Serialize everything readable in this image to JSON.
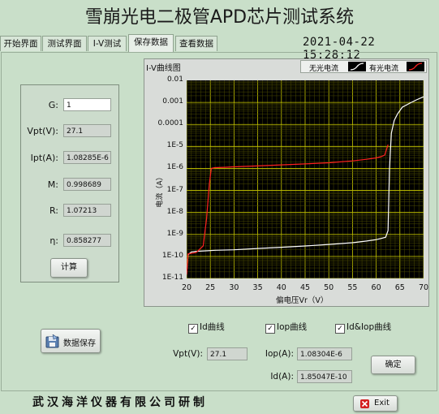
{
  "app": {
    "title": "雪崩光电二极管APD芯片测试系统"
  },
  "tabs": [
    {
      "label": "开始界面"
    },
    {
      "label": "测试界面"
    },
    {
      "label": "I-V测试"
    },
    {
      "label": "保存数据"
    },
    {
      "label": "查看数据"
    }
  ],
  "active_tab": "保存数据",
  "datetime": "2021-04-22  15:28:12",
  "params": {
    "g_label": "G:",
    "g_value": "1",
    "vpt_label": "Vpt(V):",
    "vpt_value": "27.1",
    "ipt_label": "Ipt(A):",
    "ipt_value": "1.08285E-6",
    "m_label": "M:",
    "m_value": "0.998689",
    "r_label": "R:",
    "r_value": "1.07213",
    "eta_label": "η:",
    "eta_value": "0.858277",
    "calc_button": "计算"
  },
  "save_button": "数据保存",
  "graph": {
    "title": "I-V曲线图",
    "legend_dark": "无光电流",
    "legend_light": "有光电流",
    "ylabel": "电流（A）",
    "xlabel": "偏电压Vr（V）"
  },
  "chart_data": {
    "type": "line",
    "title": "I-V曲线图",
    "xlabel": "偏电压Vr（V）",
    "ylabel": "电流（A）",
    "xlim": [
      20,
      70
    ],
    "ylim": [
      1e-11,
      0.01
    ],
    "y_scale": "log",
    "x_ticks": [
      "20",
      "25",
      "30",
      "35",
      "40",
      "45",
      "50",
      "55",
      "60",
      "65",
      "70"
    ],
    "y_ticks": [
      "1E-11",
      "1E-10",
      "1E-9",
      "1E-8",
      "1E-7",
      "1E-6",
      "1E-5",
      "0.0001",
      "0.001",
      "0.01"
    ],
    "grid": true,
    "legend_position": "top-right",
    "series": [
      {
        "name": "无光电流",
        "color": "#ffffff",
        "x": [
          20,
          20.3,
          21,
          22,
          24,
          26,
          30,
          35,
          40,
          45,
          50,
          55,
          58,
          60,
          61,
          62,
          62.5,
          62.8,
          63.2,
          63.8,
          64.5,
          65.5,
          67,
          68.5,
          70
        ],
        "y": [
          1.5e-11,
          1.2e-10,
          1.6e-10,
          1.7e-10,
          1.8e-10,
          1.9e-10,
          2e-10,
          2.3e-10,
          2.6e-10,
          3e-10,
          3.5e-10,
          4.2e-10,
          5e-10,
          5.8e-10,
          6.5e-10,
          7.5e-10,
          1.5e-09,
          1e-06,
          4e-05,
          0.00015,
          0.0003,
          0.0006,
          0.0009,
          0.0013,
          0.0018
        ]
      },
      {
        "name": "有光电流",
        "color": "#ff2020",
        "x": [
          20,
          20.3,
          22,
          23.5,
          24.2,
          24.8,
          25.2,
          26,
          28,
          30,
          35,
          40,
          45,
          50,
          55,
          58,
          60,
          61,
          61.8,
          62.5
        ],
        "y": [
          1.5e-11,
          1.3e-10,
          1.5e-10,
          3e-10,
          5e-09,
          2e-07,
          1e-06,
          1.08e-06,
          1.12e-06,
          1.18e-06,
          1.3e-06,
          1.45e-06,
          1.6e-06,
          1.8e-06,
          2.2e-06,
          2.6e-06,
          3e-06,
          3.4e-06,
          4e-06,
          1.2e-05
        ]
      }
    ]
  },
  "checkboxes": [
    {
      "label": "Id曲线",
      "checked": "✓"
    },
    {
      "label": "Iop曲线",
      "checked": "✓"
    },
    {
      "label": "Id&Iop曲线",
      "checked": "✓"
    }
  ],
  "measure": {
    "vpt_label": "Vpt(V):",
    "vpt_value": "27.1",
    "iop_label": "Iop(A):",
    "iop_value": "1.08304E-6",
    "id_label": "Id(A):",
    "id_value": "1.85047E-10",
    "confirm_button": "确定"
  },
  "footer": {
    "company": "武汉海洋仪器有限公司研制",
    "exit_button": "Exit"
  },
  "icons": {
    "save": "floppy-disk-icon",
    "exit": "exit-x-icon"
  }
}
